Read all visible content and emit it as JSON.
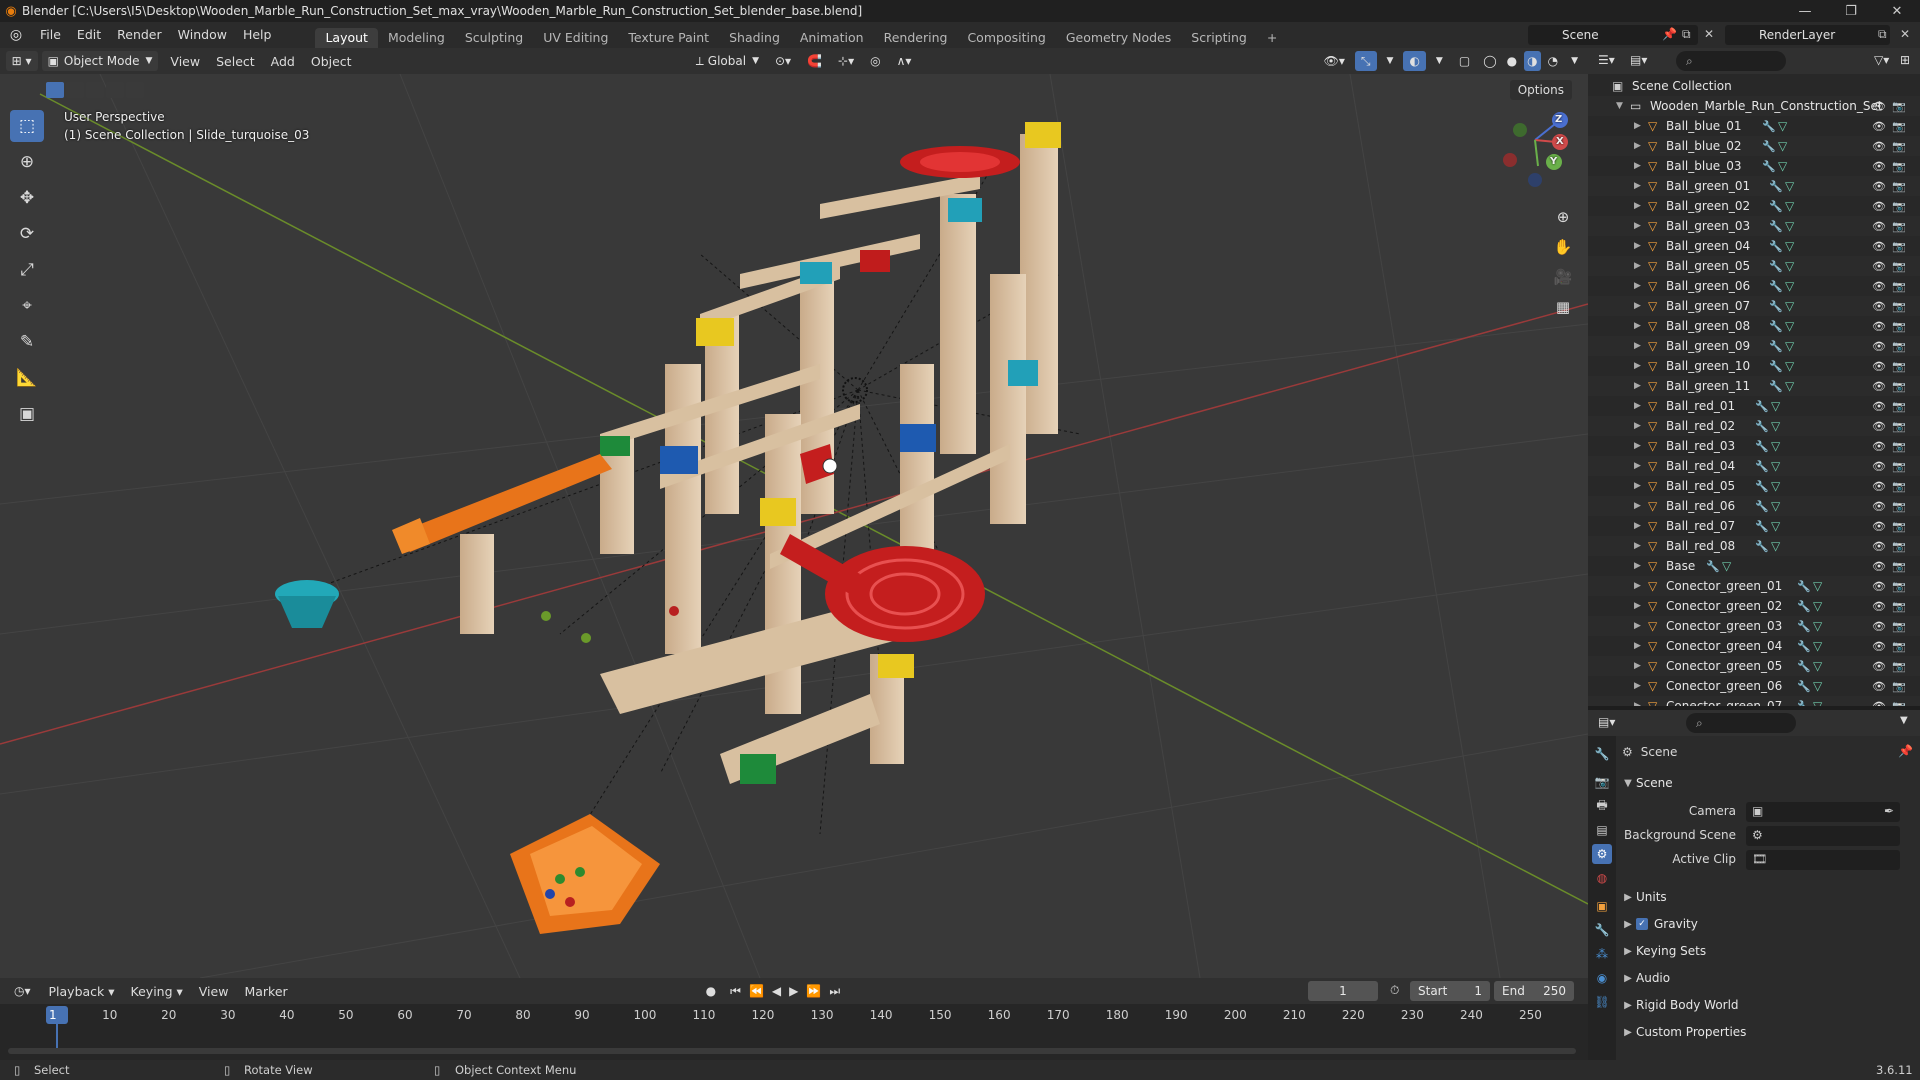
{
  "window": {
    "title": "Blender [C:\\Users\\I5\\Desktop\\Wooden_Marble_Run_Construction_Set_max_vray\\Wooden_Marble_Run_Construction_Set_blender_base.blend]",
    "minimize": "—",
    "maximize": "❐",
    "close": "✕"
  },
  "menu": {
    "items": [
      "File",
      "Edit",
      "Render",
      "Window",
      "Help"
    ]
  },
  "workspaces": {
    "tabs": [
      "Layout",
      "Modeling",
      "Sculpting",
      "UV Editing",
      "Texture Paint",
      "Shading",
      "Animation",
      "Rendering",
      "Compositing",
      "Geometry Nodes",
      "Scripting"
    ],
    "add": "+",
    "active": "Layout"
  },
  "scene_selector": {
    "value": "Scene"
  },
  "view_layer_selector": {
    "value": "RenderLayer"
  },
  "viewport_header": {
    "mode": "Object Mode",
    "menus": [
      "View",
      "Select",
      "Add",
      "Object"
    ],
    "transform_orientation": "Global",
    "options": "Options"
  },
  "viewport": {
    "perspective_label": "User Perspective",
    "context_label": "(1) Scene Collection | Slide_turquoise_03",
    "gizmo_axes": {
      "x": "X",
      "y": "Y",
      "z": "Z"
    }
  },
  "timeline": {
    "menus": [
      "Playback",
      "Keying",
      "View",
      "Marker"
    ],
    "current_frame": "1",
    "start_label": "Start",
    "start": "1",
    "end_label": "End",
    "end": "250",
    "ticks": [
      "1",
      "10",
      "20",
      "30",
      "40",
      "50",
      "60",
      "70",
      "80",
      "90",
      "100",
      "110",
      "120",
      "130",
      "140",
      "150",
      "160",
      "170",
      "180",
      "190",
      "200",
      "210",
      "220",
      "230",
      "240",
      "250"
    ]
  },
  "statusbar": {
    "select": "Select",
    "rotate": "Rotate View",
    "context_menu": "Object Context Menu",
    "version": "3.6.11"
  },
  "outliner": {
    "root": "Scene Collection",
    "collection": "Wooden_Marble_Run_Construction_Set",
    "objects": [
      "Ball_blue_01",
      "Ball_blue_02",
      "Ball_blue_03",
      "Ball_green_01",
      "Ball_green_02",
      "Ball_green_03",
      "Ball_green_04",
      "Ball_green_05",
      "Ball_green_06",
      "Ball_green_07",
      "Ball_green_08",
      "Ball_green_09",
      "Ball_green_10",
      "Ball_green_11",
      "Ball_red_01",
      "Ball_red_02",
      "Ball_red_03",
      "Ball_red_04",
      "Ball_red_05",
      "Ball_red_06",
      "Ball_red_07",
      "Ball_red_08",
      "Base",
      "Conector_green_01",
      "Conector_green_02",
      "Conector_green_03",
      "Conector_green_04",
      "Conector_green_05",
      "Conector_green_06",
      "Conector_green_07"
    ]
  },
  "properties": {
    "context": "Scene",
    "scene_panel": "Scene",
    "camera_label": "Camera",
    "background_scene_label": "Background Scene",
    "active_clip_label": "Active Clip",
    "panels": [
      "Units",
      "Gravity",
      "Keying Sets",
      "Audio",
      "Rigid Body World",
      "Custom Properties"
    ],
    "gravity_enabled": true
  },
  "colors": {
    "accent": "#4772b3",
    "object_orange": "#f2a03d",
    "frame_marker": "#4772b3"
  }
}
